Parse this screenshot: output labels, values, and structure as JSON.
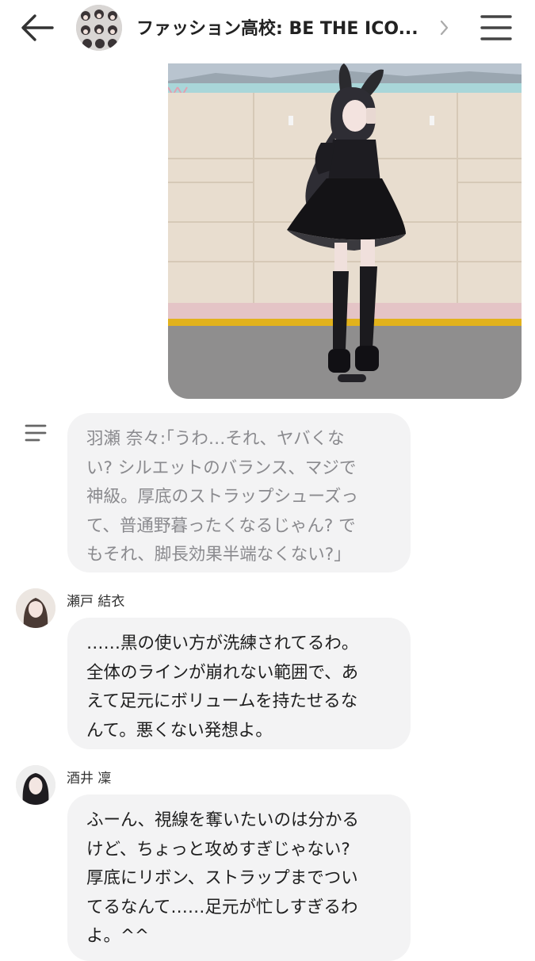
{
  "header": {
    "title": "ファッション高校: BE THE ICO...",
    "back_icon": "arrow-left-icon",
    "chevron_icon": "chevron-right-icon",
    "menu_icon": "hamburger-menu-icon"
  },
  "messages": [
    {
      "type": "narration",
      "icon": "narration-lines-icon",
      "text": "羽瀬 奈々:｢うわ…それ、ヤバくな\nい? シルエットのバランス、マジで\n神級。厚底のストラップシューズっ\nて、普通野暮ったくなるじゃん? で\nもそれ、脚長効果半端なくない?｣"
    },
    {
      "type": "character",
      "name": "瀬戸 結衣",
      "text": "……黒の使い方が洗練されてるわ。\n全体のラインが崩れない範囲で、あ\nえて足元にボリュームを持たせるな\nんて。悪くない発想よ。"
    },
    {
      "type": "character",
      "name": "酒井 凜",
      "text": "ふーん、視線を奪いたいのは分かる\nけど、ちょっと攻めすぎじゃない?\n厚底にリボン、ストラップまでつい\nてるなんて……足元が忙しすぎるわ\nよ。^^"
    }
  ],
  "colors": {
    "bubble_bg": "#f3f3f4",
    "narration_text": "#8a8a8e",
    "message_text": "#1e1e1e"
  }
}
